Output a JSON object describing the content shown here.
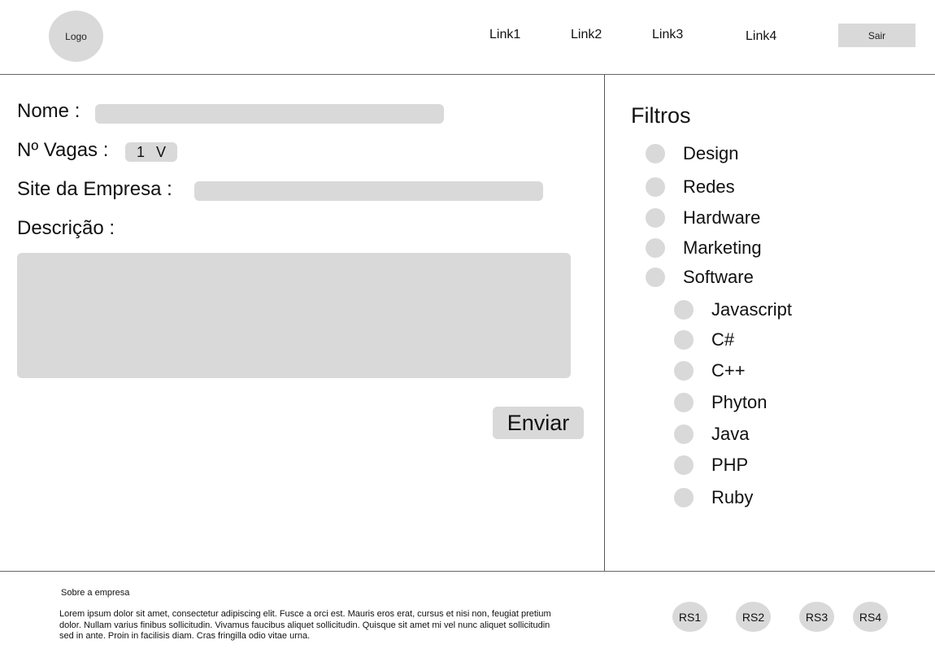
{
  "header": {
    "logo": "Logo",
    "links": [
      "Link1",
      "Link2",
      "Link3",
      "Link4"
    ],
    "logout_label": "Sair"
  },
  "form": {
    "name_label": "Nome :",
    "vagas_label": "Nº Vagas :",
    "vagas_value": "1",
    "vagas_chevron": "V",
    "site_label": "Site da Empresa :",
    "description_label": "Descrição :",
    "submit_label": "Enviar"
  },
  "filters": {
    "title": "Filtros",
    "categories": [
      "Design",
      "Redes",
      "Hardware",
      "Marketing",
      "Software"
    ],
    "software_sub": [
      "Javascript",
      "C#",
      "C++",
      "Phyton",
      "Java",
      "PHP",
      "Ruby"
    ]
  },
  "footer": {
    "title": "Sobre a empresa",
    "text": "Lorem ipsum dolor sit amet, consectetur adipiscing elit. Fusce a orci est. Mauris eros erat, cursus et nisi non, feugiat pretium dolor. Nullam varius finibus sollicitudin. Vivamus faucibus aliquet sollicitudin. Quisque sit amet mi vel nunc aliquet sollicitudin sed in ante. Proin in facilisis diam. Cras fringilla odio vitae urna.",
    "social": [
      "RS1",
      "RS2",
      "RS3",
      "RS4"
    ]
  }
}
